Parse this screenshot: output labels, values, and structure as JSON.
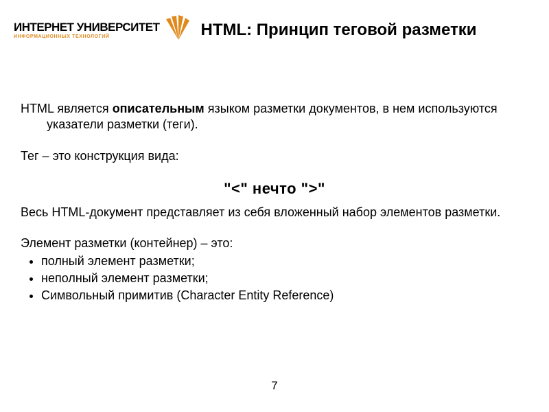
{
  "header": {
    "logo_main": "ИНТЕРНЕТ УНИВЕРСИТЕТ",
    "logo_sub": "ИНФОРМАЦИОННЫХ ТЕХНОЛОГИЙ",
    "title": "HTML: Принцип теговой разметки"
  },
  "body": {
    "p1_prefix": "HTML является ",
    "p1_bold": "описательным",
    "p1_suffix": " языком разметки документов, в нем используются указатели разметки (теги).",
    "p2": "Тег – это конструкция вида:",
    "tag_line": "\"<\" нечто \">\"",
    "p3": "Весь HTML-документ представляет из себя вложенный набор элементов разметки.",
    "p4_intro": "Элемент разметки (контейнер) – это:",
    "bullets": [
      "полный элемент разметки;",
      "неполный элемент разметки;",
      "Символьный примитив (Character Entity Reference)"
    ]
  },
  "page_number": "7"
}
